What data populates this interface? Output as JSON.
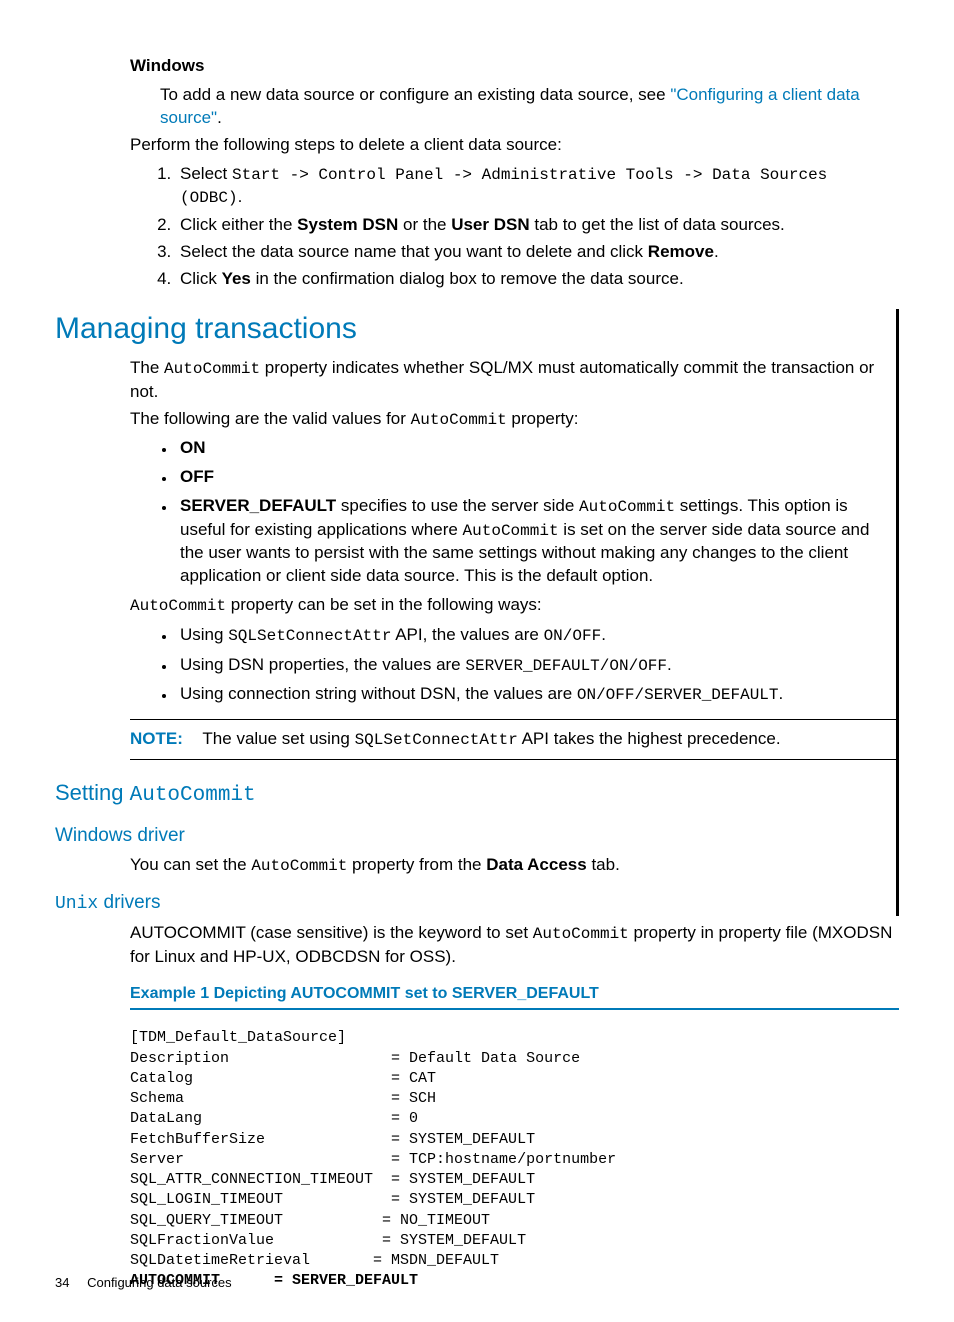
{
  "windows": {
    "head": "Windows",
    "add_text_pre": "To add a new data source or configure an existing data source, see ",
    "add_link": "\"Configuring a client data source\"",
    "add_text_post": ".",
    "delete_intro": "Perform the following steps to delete a client data source:",
    "steps": {
      "s1_pre": "Select ",
      "s1_code": "Start -> Control Panel -> Administrative Tools -> Data Sources (ODBC)",
      "s1_post": ".",
      "s2_a": "Click either the ",
      "s2_b": "System DSN",
      "s2_c": " or the ",
      "s2_d": "User DSN",
      "s2_e": " tab to get the list of data sources.",
      "s3_a": "Select the data source name that you want to delete and click ",
      "s3_b": "Remove",
      "s3_c": ".",
      "s4_a": "Click ",
      "s4_b": "Yes",
      "s4_c": " in the confirmation dialog box to remove the data source."
    }
  },
  "managing": {
    "title": "Managing transactions",
    "p1_a": "The ",
    "p1_b": "AutoCommit",
    "p1_c": " property indicates whether SQL/MX must automatically commit the transaction or not.",
    "p2_a": "The following are the valid values for ",
    "p2_b": "AutoCommit",
    "p2_c": " property:",
    "on": "ON",
    "off": "OFF",
    "sd_label": "SERVER_DEFAULT",
    "sd_a": " specifies to use the server side ",
    "sd_b": "AutoCommit",
    "sd_c": " settings. This option is useful for existing applications where ",
    "sd_d": "AutoCommit",
    "sd_e": " is set on the server side data source and the user wants to persist with the same settings without making any changes to the client application or client side data source. This is the default option.",
    "p3_a": "AutoCommit",
    "p3_b": " property can be set in the following ways:",
    "w1_a": "Using ",
    "w1_b": "SQLSetConnectAttr",
    "w1_c": " API, the values are ",
    "w1_d": "ON/OFF",
    "w1_e": ".",
    "w2_a": "Using DSN properties, the values are ",
    "w2_b": "SERVER_DEFAULT/ON/OFF",
    "w2_c": ".",
    "w3_a": "Using connection string without DSN, the values are ",
    "w3_b": "ON/OFF/SERVER_DEFAULT",
    "w3_c": "."
  },
  "note": {
    "label": "NOTE:",
    "a": "The value set using ",
    "b": "SQLSetConnectAttr",
    "c": " API takes the highest precedence."
  },
  "setting": {
    "title_a": "Setting ",
    "title_b": "AutoCommit",
    "win_title": "Windows driver",
    "win_a": "You can set the ",
    "win_b": "AutoCommit",
    "win_c": " property from the ",
    "win_d": "Data Access",
    "win_e": " tab.",
    "unix_title_a": "Unix",
    "unix_title_b": " drivers",
    "unix_a": "AUTOCOMMIT (case sensitive) is the keyword to set ",
    "unix_b": "AutoCommit",
    "unix_c": " property in property file (MXODSN for Linux and HP-UX, ODBCDSN for OSS)."
  },
  "example": {
    "title": "Example 1 Depicting AUTOCOMMIT set to SERVER_DEFAULT",
    "lines": {
      "l0": "[TDM_Default_DataSource]",
      "l1": "Description                  = Default Data Source",
      "l2": "Catalog                      = CAT",
      "l3": "Schema                       = SCH",
      "l4": "DataLang                     = 0",
      "l5": "FetchBufferSize              = SYSTEM_DEFAULT",
      "l6": "Server                       = TCP:hostname/portnumber",
      "l7": "SQL_ATTR_CONNECTION_TIMEOUT  = SYSTEM_DEFAULT",
      "l8": "SQL_LOGIN_TIMEOUT            = SYSTEM_DEFAULT",
      "l9": "SQL_QUERY_TIMEOUT           = NO_TIMEOUT",
      "l10": "SQLFractionValue            = SYSTEM_DEFAULT",
      "l11": "SQLDatetimeRetrieval       = MSDN_DEFAULT",
      "l12": "AUTOCOMMIT      = SERVER_DEFAULT"
    }
  },
  "footer": {
    "page": "34",
    "label": "Configuring data sources"
  }
}
